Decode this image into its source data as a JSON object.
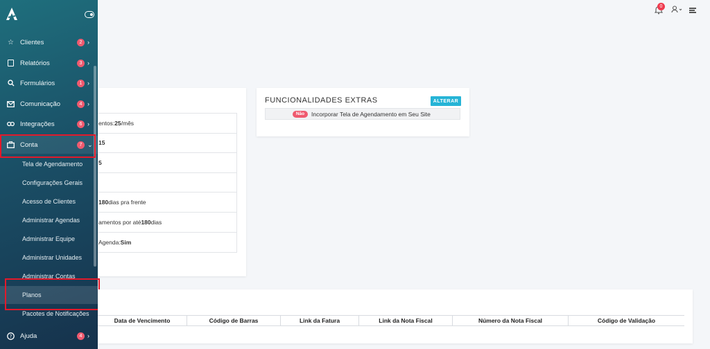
{
  "sidebar": {
    "main_items": [
      {
        "label": "Clientes",
        "badge": "2",
        "icon": "star-icon"
      },
      {
        "label": "Relatórios",
        "badge": "3",
        "icon": "book-icon"
      },
      {
        "label": "Formulários",
        "badge": "1",
        "icon": "search-icon"
      },
      {
        "label": "Comunicação",
        "badge": "4",
        "icon": "mail-icon"
      },
      {
        "label": "Integrações",
        "badge": "6",
        "icon": "link-icon"
      },
      {
        "label": "Conta",
        "badge": "7",
        "icon": "briefcase-icon"
      }
    ],
    "sub_items": [
      "Tela de Agendamento",
      "Configurações Gerais",
      "Acesso de Clientes",
      "Administrar Agendas",
      "Administrar Equipe",
      "Administrar Unidades",
      "Administrar Contas",
      "Planos",
      "Pacotes de Notificações"
    ],
    "help": {
      "label": "Ajuda",
      "badge": "4"
    }
  },
  "topbar": {
    "notification_count": "0"
  },
  "plan": {
    "rows": [
      {
        "pre": "entos: ",
        "bold": "25",
        "post": "/mês"
      },
      {
        "pre": "",
        "bold": "15",
        "post": ""
      },
      {
        "pre": "",
        "bold": "5",
        "post": ""
      },
      {
        "pre": "",
        "bold": "",
        "post": ""
      },
      {
        "pre": "",
        "bold": "180",
        "post": " dias pra frente"
      },
      {
        "pre": "amentos por até ",
        "bold": "180",
        "post": " dias"
      },
      {
        "pre": "Agenda: ",
        "bold": "Sim",
        "post": ""
      }
    ]
  },
  "extras": {
    "title": "FUNCIONALIDADES EXTRAS",
    "button": "ALTERAR",
    "item_status": "Não",
    "item_label": "Incorporar Tela de Agendamento em Seu Site"
  },
  "invoices": {
    "columns": [
      "Data de Vencimento",
      "Código de Barras",
      "Link da Fatura",
      "Link da Nota Fiscal",
      "Número da Nota Fiscal",
      "Código de Validação"
    ]
  }
}
